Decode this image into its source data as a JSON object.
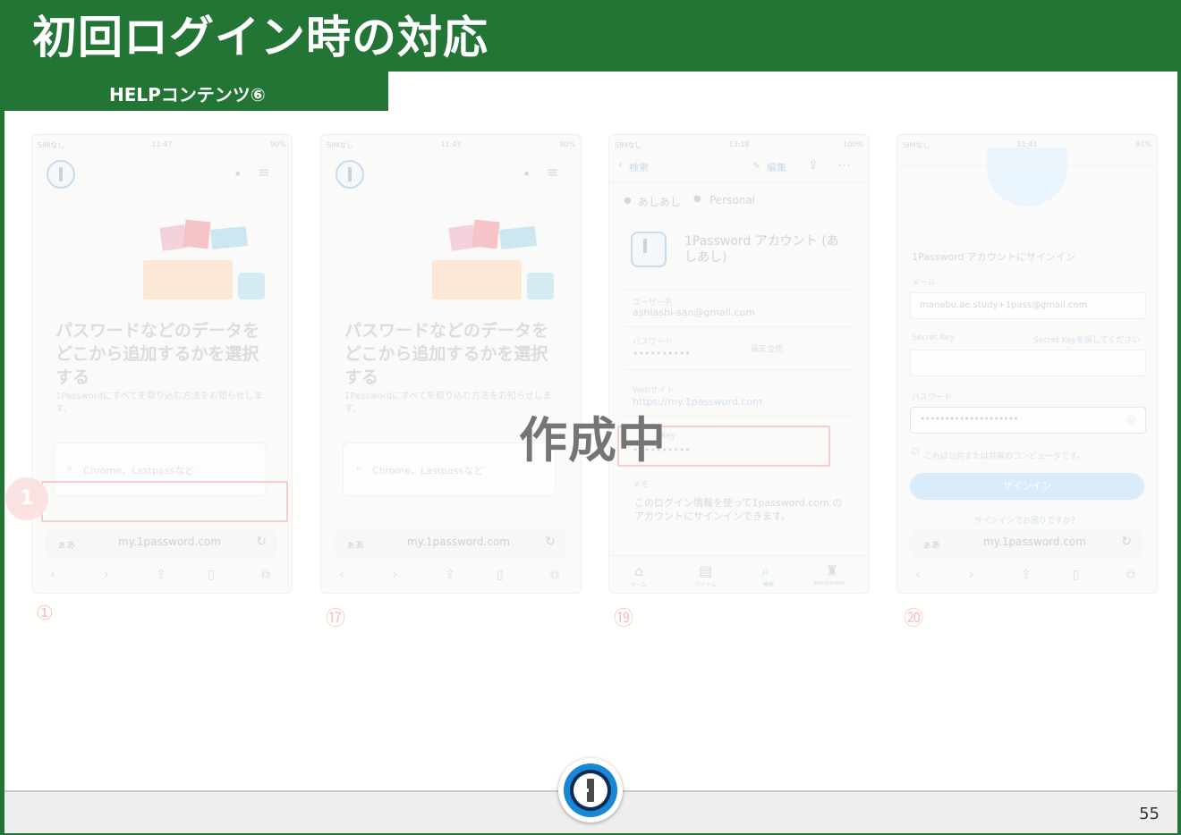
{
  "title": "初回ログイン時の対応",
  "subtitle": "HELPコンテンツ⑥",
  "overlay_text": "作成中",
  "page_number": "55",
  "phone1": {
    "status_left": "SIMなし",
    "status_time": "11:47",
    "status_battery": "90%",
    "heading": "パスワードなどのデータを\nどこから追加するかを選択\nする",
    "desc": "1Passwordにすべてを取り込む方法をお知らせします。",
    "search_placeholder": "Chrome、Lastpassなど",
    "url_aa": "ぁあ",
    "url": "my.1password.com",
    "step_marker": "1",
    "caption": "①"
  },
  "phone2": {
    "status_left": "SIMなし",
    "status_time": "11:47",
    "status_battery": "90%",
    "heading": "パスワードなどのデータを\nどこから追加するかを選択\nする",
    "desc": "1Passwordにすべてを取り込む方法をお知らせします。",
    "search_placeholder": "Chrome、Lastpassなど",
    "url_aa": "ぁあ",
    "url": "my.1password.com",
    "caption": "⑰"
  },
  "phone3": {
    "status_left": "SIMなし",
    "status_time": "13:18",
    "status_battery": "100%",
    "back_label": "検索",
    "edit_label": "編集",
    "owner": "あしあし",
    "vault": "Personal",
    "item_title": "1Password アカウント (あしあし)",
    "username_label": "ユーザー名",
    "username_value": "ashiashi-san@gmail.com",
    "password_label": "パスワード",
    "password_value": "••••••••••",
    "password_strength": "最安全性",
    "website_label": "Webサイト",
    "website_value": "https://my.1password.com",
    "secret_key_label": "Key",
    "secret_key_value": "••••••••••",
    "memo_label": "メモ",
    "memo_value": "このログイン情報を使って1password.com のアカウントにサインインできます。",
    "tab_home": "ホーム",
    "tab_items": "アイテム",
    "tab_search": "検索",
    "tab_watchtower": "Watchtower",
    "caption": "⑲"
  },
  "phone4": {
    "status_left": "SIMなし",
    "status_time": "11:41",
    "status_battery": "91%",
    "signin_title": "1Password アカウントにサインイン",
    "email_label": "メール",
    "email_value": "manabu.ae.study+1pass@gmail.com",
    "secret_key_label": "Secret Key",
    "secret_key_help": "Secret Keyを探してください",
    "password_label": "パスワード",
    "password_value": "••••••••••••••••••••",
    "public_computer": "これは公共または共有のコンピュータです。",
    "signin_button": "サインイン",
    "signin_help": "サインインでお困りですか？",
    "url_aa": "ぁあ",
    "url": "my.1password.com",
    "caption": "⑳"
  },
  "colors": {
    "brand_green": "#227535",
    "logo_blue": "#1a86d6",
    "marker_red": "#f6cccc"
  },
  "icons": {
    "bottom_logo": "1password-logo-icon"
  }
}
